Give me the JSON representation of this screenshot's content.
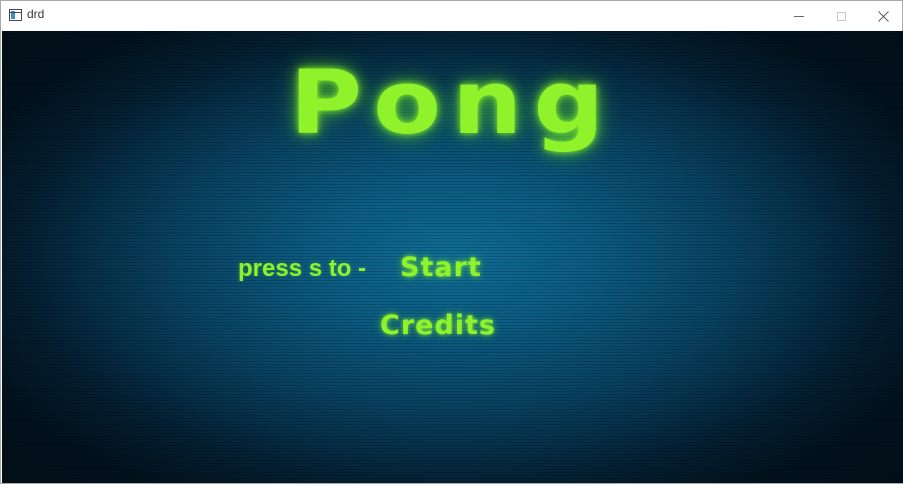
{
  "window": {
    "title": "drd",
    "minimize_icon": "minimize-icon",
    "maximize_icon": "maximize-icon",
    "close_icon": "close-icon",
    "close_glyph": "✕"
  },
  "game": {
    "title": "Pong",
    "prompt": "press s to -",
    "menu": {
      "start": "Start",
      "credits": "Credits"
    },
    "colors": {
      "text": "#8ff22a",
      "background_center": "#0f6d97",
      "background_edge": "#021522"
    }
  }
}
